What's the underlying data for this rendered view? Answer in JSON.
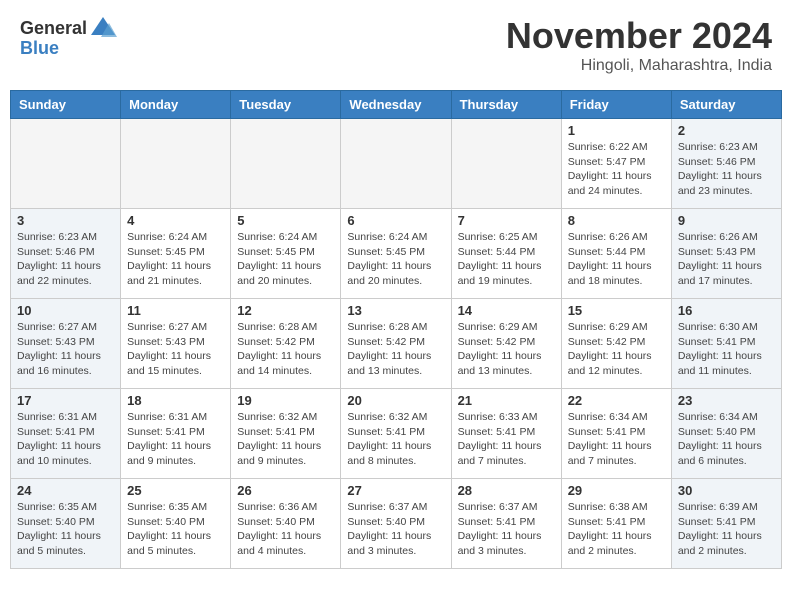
{
  "header": {
    "logo_general": "General",
    "logo_blue": "Blue",
    "month_title": "November 2024",
    "location": "Hingoli, Maharashtra, India"
  },
  "calendar": {
    "days_of_week": [
      "Sunday",
      "Monday",
      "Tuesday",
      "Wednesday",
      "Thursday",
      "Friday",
      "Saturday"
    ],
    "weeks": [
      [
        {
          "day": "",
          "info": ""
        },
        {
          "day": "",
          "info": ""
        },
        {
          "day": "",
          "info": ""
        },
        {
          "day": "",
          "info": ""
        },
        {
          "day": "",
          "info": ""
        },
        {
          "day": "1",
          "info": "Sunrise: 6:22 AM\nSunset: 5:47 PM\nDaylight: 11 hours and 24 minutes."
        },
        {
          "day": "2",
          "info": "Sunrise: 6:23 AM\nSunset: 5:46 PM\nDaylight: 11 hours and 23 minutes."
        }
      ],
      [
        {
          "day": "3",
          "info": "Sunrise: 6:23 AM\nSunset: 5:46 PM\nDaylight: 11 hours and 22 minutes."
        },
        {
          "day": "4",
          "info": "Sunrise: 6:24 AM\nSunset: 5:45 PM\nDaylight: 11 hours and 21 minutes."
        },
        {
          "day": "5",
          "info": "Sunrise: 6:24 AM\nSunset: 5:45 PM\nDaylight: 11 hours and 20 minutes."
        },
        {
          "day": "6",
          "info": "Sunrise: 6:24 AM\nSunset: 5:45 PM\nDaylight: 11 hours and 20 minutes."
        },
        {
          "day": "7",
          "info": "Sunrise: 6:25 AM\nSunset: 5:44 PM\nDaylight: 11 hours and 19 minutes."
        },
        {
          "day": "8",
          "info": "Sunrise: 6:26 AM\nSunset: 5:44 PM\nDaylight: 11 hours and 18 minutes."
        },
        {
          "day": "9",
          "info": "Sunrise: 6:26 AM\nSunset: 5:43 PM\nDaylight: 11 hours and 17 minutes."
        }
      ],
      [
        {
          "day": "10",
          "info": "Sunrise: 6:27 AM\nSunset: 5:43 PM\nDaylight: 11 hours and 16 minutes."
        },
        {
          "day": "11",
          "info": "Sunrise: 6:27 AM\nSunset: 5:43 PM\nDaylight: 11 hours and 15 minutes."
        },
        {
          "day": "12",
          "info": "Sunrise: 6:28 AM\nSunset: 5:42 PM\nDaylight: 11 hours and 14 minutes."
        },
        {
          "day": "13",
          "info": "Sunrise: 6:28 AM\nSunset: 5:42 PM\nDaylight: 11 hours and 13 minutes."
        },
        {
          "day": "14",
          "info": "Sunrise: 6:29 AM\nSunset: 5:42 PM\nDaylight: 11 hours and 13 minutes."
        },
        {
          "day": "15",
          "info": "Sunrise: 6:29 AM\nSunset: 5:42 PM\nDaylight: 11 hours and 12 minutes."
        },
        {
          "day": "16",
          "info": "Sunrise: 6:30 AM\nSunset: 5:41 PM\nDaylight: 11 hours and 11 minutes."
        }
      ],
      [
        {
          "day": "17",
          "info": "Sunrise: 6:31 AM\nSunset: 5:41 PM\nDaylight: 11 hours and 10 minutes."
        },
        {
          "day": "18",
          "info": "Sunrise: 6:31 AM\nSunset: 5:41 PM\nDaylight: 11 hours and 9 minutes."
        },
        {
          "day": "19",
          "info": "Sunrise: 6:32 AM\nSunset: 5:41 PM\nDaylight: 11 hours and 9 minutes."
        },
        {
          "day": "20",
          "info": "Sunrise: 6:32 AM\nSunset: 5:41 PM\nDaylight: 11 hours and 8 minutes."
        },
        {
          "day": "21",
          "info": "Sunrise: 6:33 AM\nSunset: 5:41 PM\nDaylight: 11 hours and 7 minutes."
        },
        {
          "day": "22",
          "info": "Sunrise: 6:34 AM\nSunset: 5:41 PM\nDaylight: 11 hours and 7 minutes."
        },
        {
          "day": "23",
          "info": "Sunrise: 6:34 AM\nSunset: 5:40 PM\nDaylight: 11 hours and 6 minutes."
        }
      ],
      [
        {
          "day": "24",
          "info": "Sunrise: 6:35 AM\nSunset: 5:40 PM\nDaylight: 11 hours and 5 minutes."
        },
        {
          "day": "25",
          "info": "Sunrise: 6:35 AM\nSunset: 5:40 PM\nDaylight: 11 hours and 5 minutes."
        },
        {
          "day": "26",
          "info": "Sunrise: 6:36 AM\nSunset: 5:40 PM\nDaylight: 11 hours and 4 minutes."
        },
        {
          "day": "27",
          "info": "Sunrise: 6:37 AM\nSunset: 5:40 PM\nDaylight: 11 hours and 3 minutes."
        },
        {
          "day": "28",
          "info": "Sunrise: 6:37 AM\nSunset: 5:41 PM\nDaylight: 11 hours and 3 minutes."
        },
        {
          "day": "29",
          "info": "Sunrise: 6:38 AM\nSunset: 5:41 PM\nDaylight: 11 hours and 2 minutes."
        },
        {
          "day": "30",
          "info": "Sunrise: 6:39 AM\nSunset: 5:41 PM\nDaylight: 11 hours and 2 minutes."
        }
      ]
    ]
  }
}
